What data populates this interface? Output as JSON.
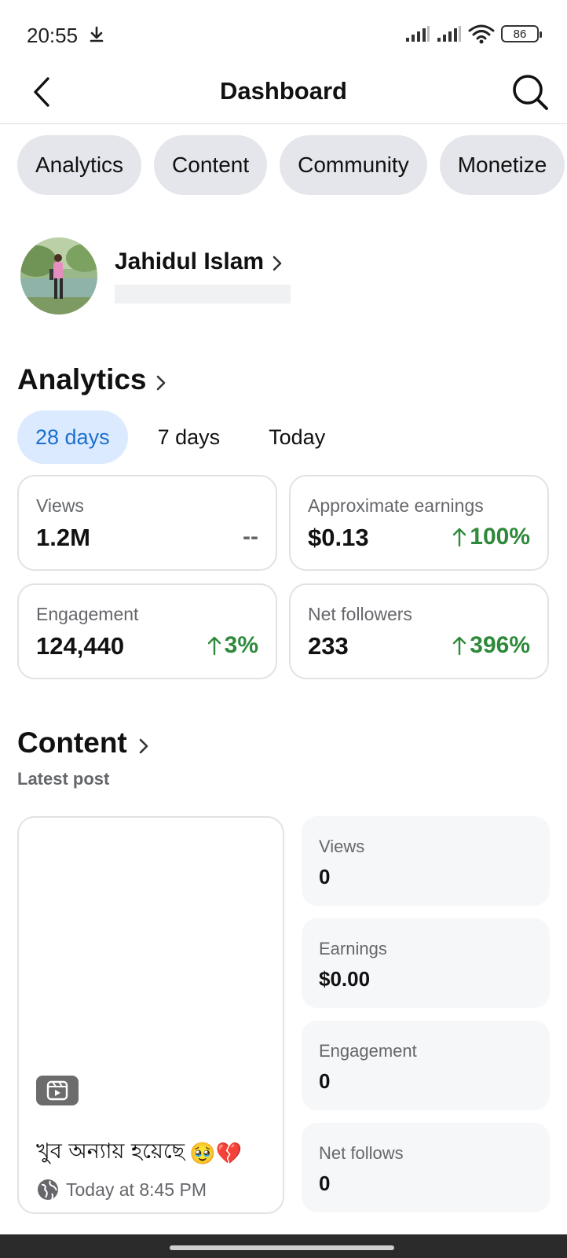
{
  "status_bar": {
    "time": "20:55",
    "battery": "86"
  },
  "header": {
    "title": "Dashboard"
  },
  "chips": [
    "Analytics",
    "Content",
    "Community",
    "Monetize"
  ],
  "profile": {
    "name": "Jahidul Islam"
  },
  "analytics": {
    "title": "Analytics",
    "tabs": [
      "28 days",
      "7 days",
      "Today"
    ],
    "active_tab": "28 days",
    "cards": [
      {
        "label": "Views",
        "value": "1.2M",
        "change": "--"
      },
      {
        "label": "Approximate earnings",
        "value": "$0.13",
        "change": "100%"
      },
      {
        "label": "Engagement",
        "value": "124,440",
        "change": "3%"
      },
      {
        "label": "Net followers",
        "value": "233",
        "change": "396%"
      }
    ],
    "colors": {
      "positive": "#2e8a3a",
      "active_tab_bg": "#dbeafe",
      "active_tab_text": "#1b6fcf"
    }
  },
  "content": {
    "title": "Content",
    "subtitle": "Latest post",
    "post": {
      "caption": "খুব অন্যায় হয়েছে",
      "emojis": "🥹💔",
      "time": "Today at 8:45 PM",
      "type_icon": "reel-icon"
    },
    "metrics": [
      {
        "label": "Views",
        "value": "0"
      },
      {
        "label": "Earnings",
        "value": "$0.00"
      },
      {
        "label": "Engagement",
        "value": "0"
      },
      {
        "label": "Net follows",
        "value": "0"
      }
    ]
  }
}
